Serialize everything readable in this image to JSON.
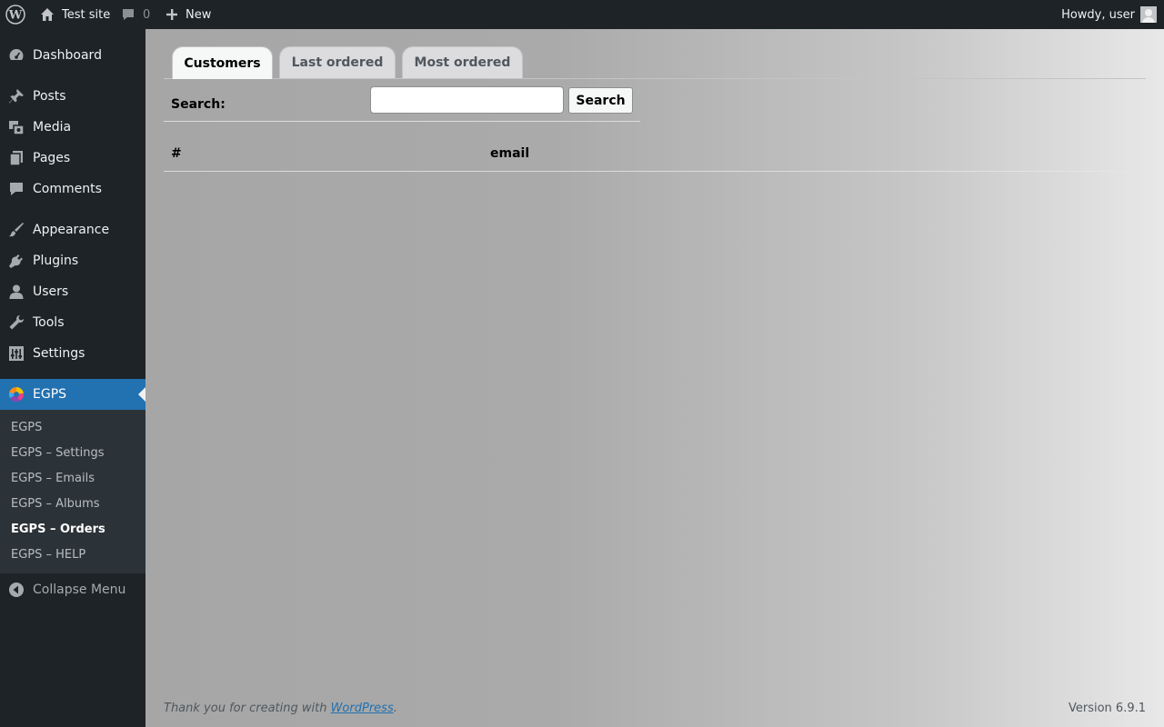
{
  "adminbar": {
    "site_name": "Test site",
    "comments_count": "0",
    "new_label": "New",
    "howdy": "Howdy, user"
  },
  "menu": {
    "items": [
      {
        "label": "Dashboard",
        "icon": "dashboard-icon"
      },
      {
        "label": "Posts",
        "icon": "pin-icon"
      },
      {
        "label": "Media",
        "icon": "media-icon"
      },
      {
        "label": "Pages",
        "icon": "pages-icon"
      },
      {
        "label": "Comments",
        "icon": "comment-icon"
      },
      {
        "label": "Appearance",
        "icon": "brush-icon"
      },
      {
        "label": "Plugins",
        "icon": "plug-icon"
      },
      {
        "label": "Users",
        "icon": "user-icon"
      },
      {
        "label": "Tools",
        "icon": "wrench-icon"
      },
      {
        "label": "Settings",
        "icon": "sliders-icon"
      },
      {
        "label": "EGPS",
        "icon": "egps-logo-icon"
      }
    ],
    "submenu": [
      "EGPS",
      "EGPS – Settings",
      "EGPS – Emails",
      "EGPS – Albums",
      "EGPS – Orders",
      "EGPS – HELP"
    ],
    "collapse": "Collapse Menu"
  },
  "tabs": [
    "Customers",
    "Last ordered",
    "Most ordered"
  ],
  "search": {
    "label": "Search:",
    "value": "",
    "button": "Search"
  },
  "table": {
    "columns": [
      "#",
      "email"
    ]
  },
  "footer": {
    "thanks_prefix": "Thank you for creating with ",
    "thanks_link": "WordPress",
    "thanks_suffix": ".",
    "version": "Version 6.9.1"
  },
  "colors": {
    "adminbar_bg": "#1d2327",
    "menu_current_bg": "#2271b1",
    "submenu_bg": "#2c3338"
  }
}
